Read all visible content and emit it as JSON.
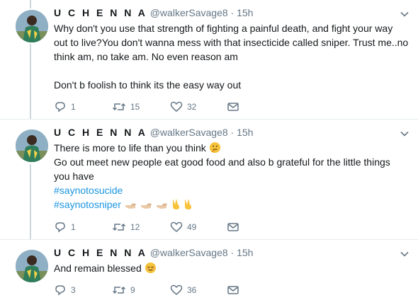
{
  "tweets": [
    {
      "name": "U C H E N N A",
      "handle": "@walkerSavage8",
      "separator": "·",
      "time": "15h",
      "line1": "Why don't you use that strength of fighting a painful death, and fight your way",
      "line2": "out to live?You don't wanna mess with that insecticide called sniper. Trust me..no",
      "line3": "think am, no take am. No even reason am",
      "line4": "Don't b foolish to think its the easy way out",
      "replies": "1",
      "retweets": "15",
      "likes": "32"
    },
    {
      "name": "U C H E N N A",
      "handle": "@walkerSavage8",
      "separator": "·",
      "time": "15h",
      "line1": "There is more to life than you think",
      "line2": "Go out meet new people eat good food and also b grateful for the little things",
      "line3": "you have",
      "hashtag1": "#saynotosucide",
      "hashtag2": "#saynotosniper",
      "replies": "1",
      "retweets": "12",
      "likes": "49"
    },
    {
      "name": "U C H E N N A",
      "handle": "@walkerSavage8",
      "separator": "·",
      "time": "15h",
      "line1": "And remain blessed",
      "replies": "3",
      "retweets": "9",
      "likes": "36"
    }
  ],
  "icons": {
    "reply": "reply-icon",
    "retweet": "retweet-icon",
    "like": "heart-icon",
    "dm": "envelope-icon",
    "caret": "chevron-down-icon",
    "thinking": "thinking-face-emoji",
    "pointing": "pointing-hand-emoji",
    "victory": "victory-hand-emoji",
    "relieved": "relieved-face-emoji"
  },
  "colors": {
    "hashtag": "#1b95e0",
    "secondary_text": "#657786",
    "thread_line": "#ccd6dd",
    "divider": "#e6ecf0"
  }
}
